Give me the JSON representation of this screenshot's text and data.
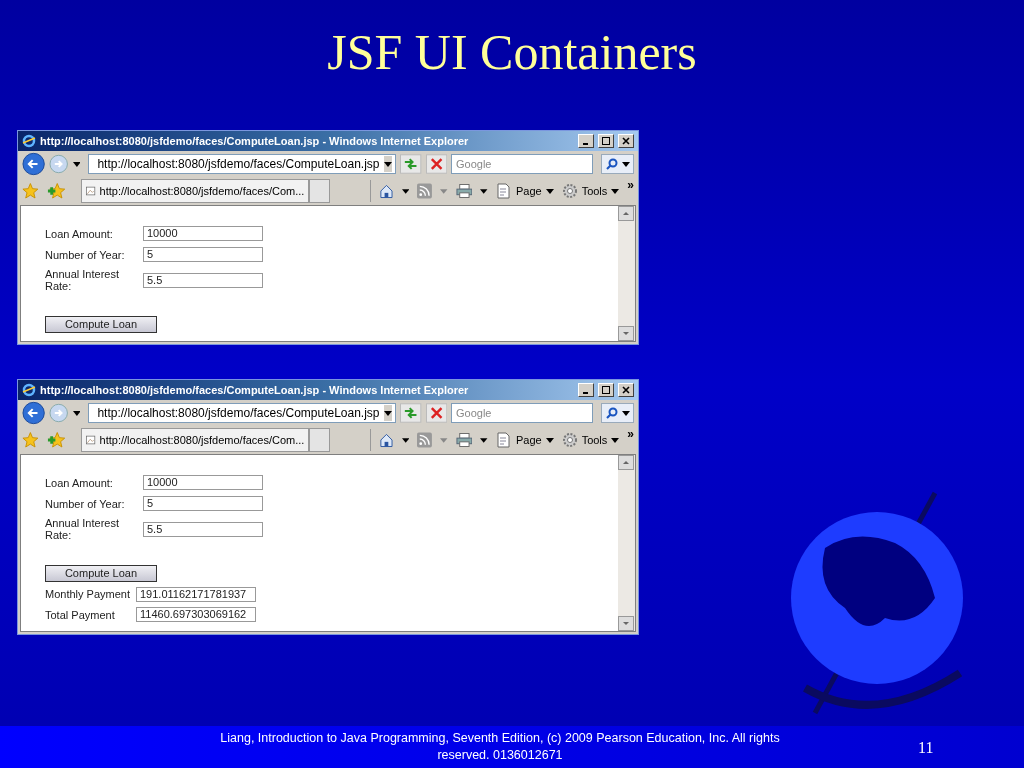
{
  "slide": {
    "title": "JSF UI Containers",
    "footer": "Liang, Introduction to Java Programming, Seventh Edition, (c) 2009 Pearson Education, Inc. All rights reserved. 0136012671",
    "page_number": "11"
  },
  "windows": [
    {
      "title": "http://localhost:8080/jsfdemo/faces/ComputeLoan.jsp - Windows Internet Explorer",
      "address": "http://localhost:8080/jsfdemo/faces/ComputeLoan.jsp",
      "search_placeholder": "Google",
      "tab_title": "http://localhost:8080/jsfdemo/faces/Com...",
      "commands": [
        "Page",
        "Tools"
      ],
      "more": "»",
      "fields": [
        {
          "label": "Loan Amount:",
          "value": "10000"
        },
        {
          "label": "Number of Year:",
          "value": "5"
        },
        {
          "label": "Annual Interest Rate:",
          "value": "5.5"
        }
      ],
      "button": "Compute Loan"
    },
    {
      "title": "http://localhost:8080/jsfdemo/faces/ComputeLoan.jsp - Windows Internet Explorer",
      "address": "http://localhost:8080/jsfdemo/faces/ComputeLoan.jsp",
      "search_placeholder": "Google",
      "tab_title": "http://localhost:8080/jsfdemo/faces/Com...",
      "commands": [
        "Page",
        "Tools"
      ],
      "more": "»",
      "fields": [
        {
          "label": "Loan Amount:",
          "value": "10000"
        },
        {
          "label": "Number of Year:",
          "value": "5"
        },
        {
          "label": "Annual Interest Rate:",
          "value": "5.5"
        }
      ],
      "button": "Compute Loan",
      "results": [
        {
          "label": "Monthly Payment",
          "value": "191.01162171781937"
        },
        {
          "label": "Total Payment",
          "value": "11460.697303069162"
        }
      ]
    }
  ]
}
